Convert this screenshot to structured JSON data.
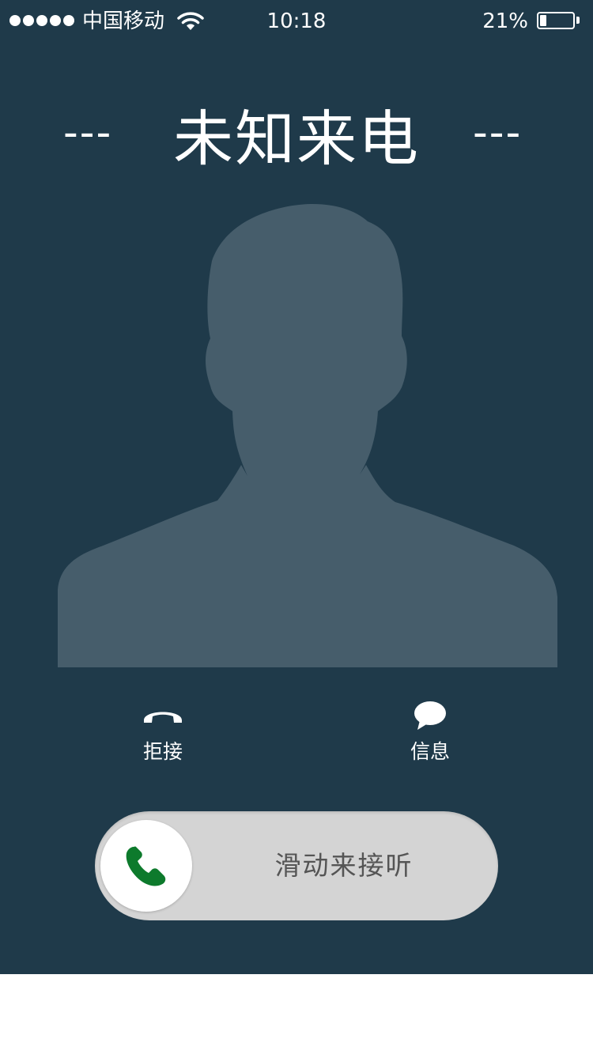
{
  "status_bar": {
    "carrier": "中国移动",
    "time": "10:18",
    "battery_percent": "21%",
    "battery_level": 0.21
  },
  "call": {
    "left_decoration": "---",
    "caller_name": "未知来电",
    "right_decoration": "---"
  },
  "actions": {
    "decline_label": "拒接",
    "message_label": "信息"
  },
  "slider": {
    "label": "滑动来接听"
  },
  "colors": {
    "background": "#1f3a4a",
    "silhouette": "#465d6b",
    "answer_green": "#0d7a2c",
    "slider_track": "#d4d4d4"
  },
  "icons": {
    "wifi": "wifi-icon",
    "battery": "battery-icon",
    "decline": "hang-up-icon",
    "message": "chat-bubble-icon",
    "answer": "phone-answer-icon"
  }
}
